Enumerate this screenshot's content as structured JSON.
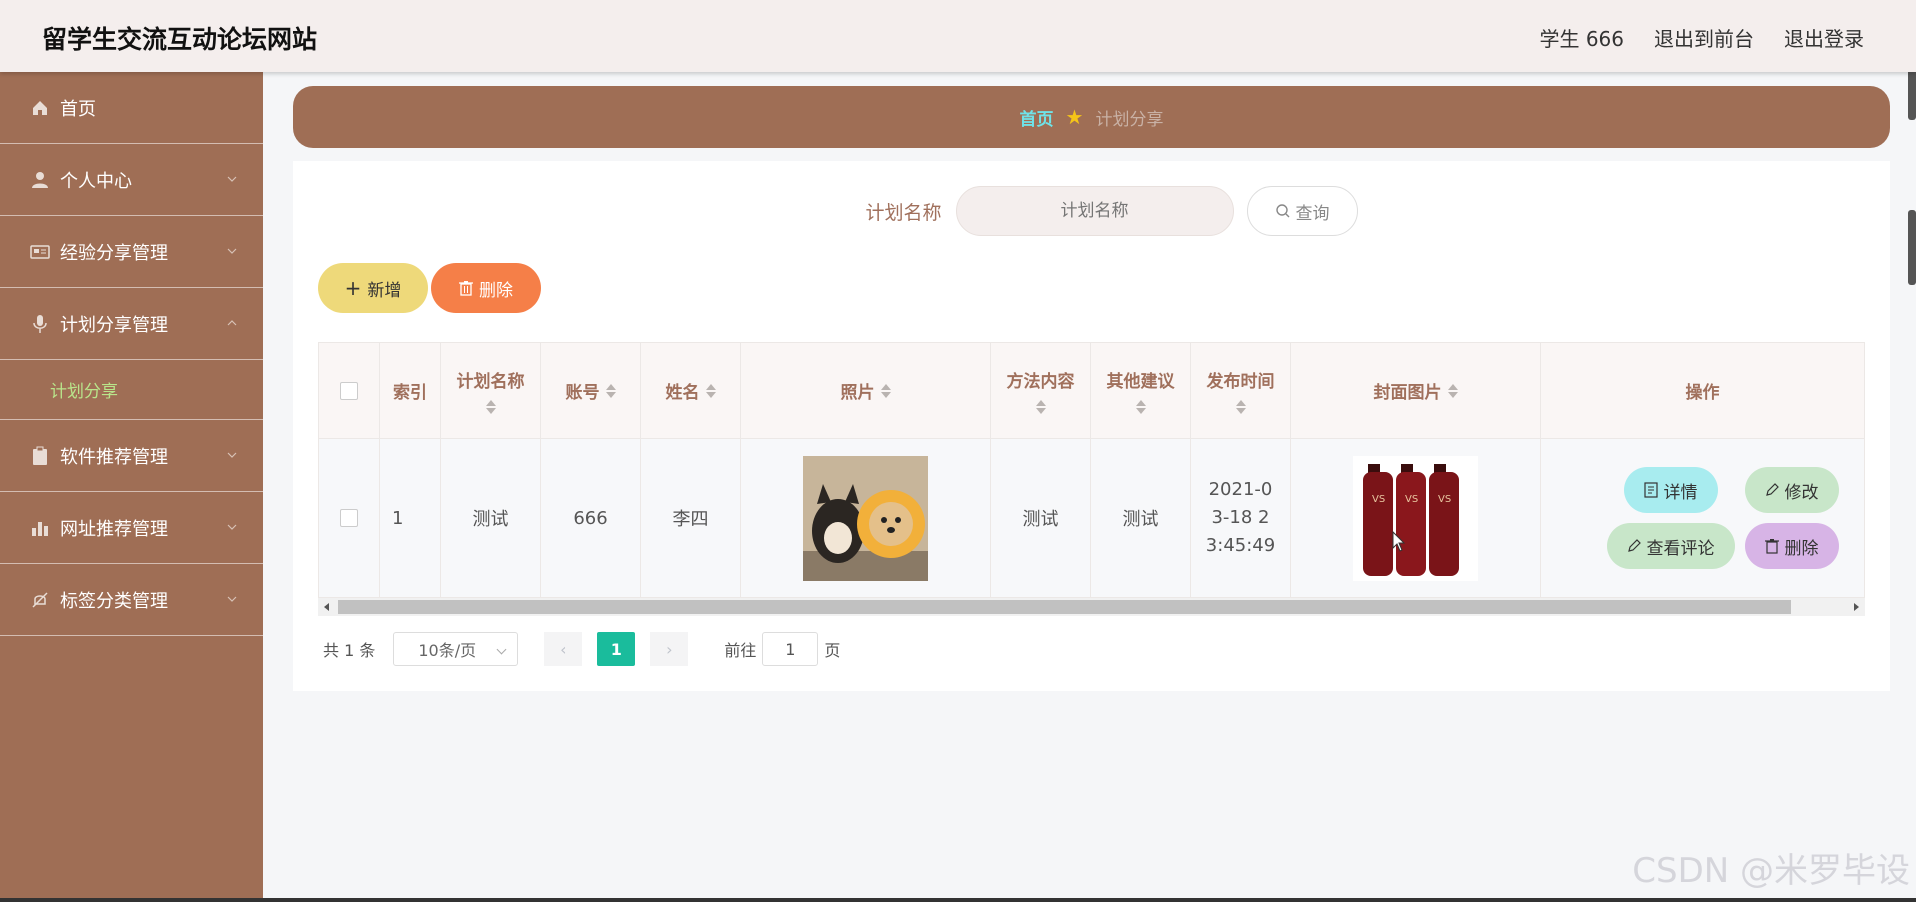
{
  "header": {
    "site_title": "留学生交流互动论坛网站",
    "user": "学生 666",
    "front_link": "退出到前台",
    "logout_link": "退出登录"
  },
  "sidebar": {
    "items": [
      {
        "label": "首页",
        "icon": "home-icon"
      },
      {
        "label": "个人中心",
        "icon": "user-icon"
      },
      {
        "label": "经验分享管理",
        "icon": "card-icon"
      },
      {
        "label": "计划分享管理",
        "icon": "mic-icon"
      },
      {
        "label": "软件推荐管理",
        "icon": "clipboard-icon"
      },
      {
        "label": "网址推荐管理",
        "icon": "bar-chart-icon"
      },
      {
        "label": "标签分类管理",
        "icon": "bell-off-icon"
      }
    ],
    "submenu_active": "计划分享"
  },
  "breadcrumb": {
    "home": "首页",
    "current": "计划分享"
  },
  "search": {
    "label": "计划名称",
    "placeholder": "计划名称",
    "button": "查询"
  },
  "actions": {
    "add": "新增",
    "delete": "删除"
  },
  "table": {
    "headers": [
      "索引",
      "计划名称",
      "账号",
      "姓名",
      "照片",
      "方法内容",
      "其他建议",
      "发布时间",
      "封面图片",
      "操作"
    ],
    "rows": [
      {
        "index": "1",
        "plan_name": "测试",
        "account": "666",
        "name": "李四",
        "method": "测试",
        "suggestion": "测试",
        "publish_time": "2021-03-18 23:45:49"
      }
    ],
    "ops": {
      "detail": "详情",
      "edit": "修改",
      "comments": "查看评论",
      "delete": "删除"
    }
  },
  "pagination": {
    "total": "共 1 条",
    "page_size": "10条/页",
    "current": "1",
    "goto_label": "前往",
    "goto_value": "1",
    "page_unit": "页"
  },
  "watermark": "CSDN @米罗毕设",
  "colors": {
    "sidebar": "#9f6e55",
    "accent_active": "#b9e58b",
    "pager_active": "#1abc9c"
  }
}
